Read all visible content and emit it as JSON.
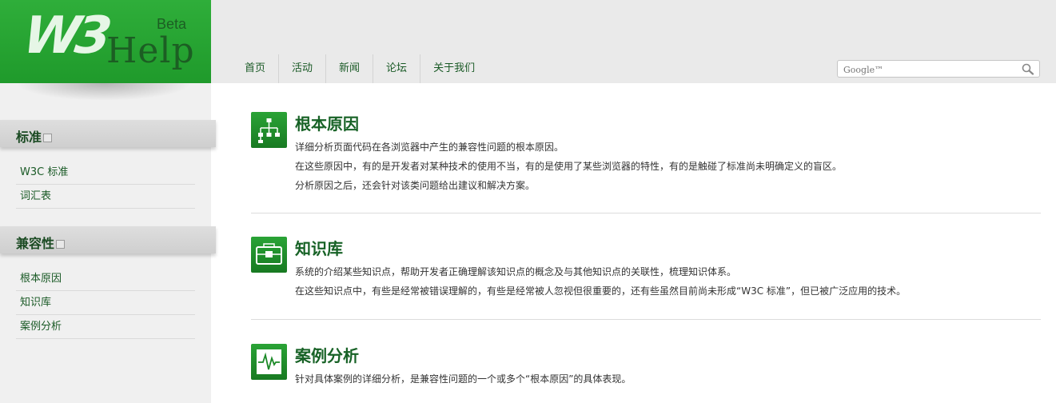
{
  "brand": {
    "logo_w3": "W3",
    "logo_help": "Help",
    "logo_beta": "Beta"
  },
  "nav": [
    {
      "label": "首页"
    },
    {
      "label": "活动"
    },
    {
      "label": "新闻"
    },
    {
      "label": "论坛"
    },
    {
      "label": "关于我们"
    }
  ],
  "search": {
    "placeholder": "Google™",
    "value": ""
  },
  "sidebar": {
    "sections": [
      {
        "title": "标准",
        "items": [
          {
            "label": "W3C 标准"
          },
          {
            "label": "词汇表"
          }
        ]
      },
      {
        "title": "兼容性",
        "items": [
          {
            "label": "根本原因"
          },
          {
            "label": "知识库"
          },
          {
            "label": "案例分析"
          }
        ]
      }
    ]
  },
  "entries": [
    {
      "title": "根本原因",
      "icon": "hierarchy-icon",
      "lines": [
        "详细分析页面代码在各浏览器中产生的兼容性问题的根本原因。",
        "在这些原因中，有的是开发者对某种技术的使用不当，有的是使用了某些浏览器的特性，有的是触碰了标准尚未明确定义的盲区。",
        "分析原因之后，还会针对该类问题给出建议和解决方案。"
      ]
    },
    {
      "title": "知识库",
      "icon": "toolbox-icon",
      "lines": [
        "系统的介绍某些知识点，帮助开发者正确理解该知识点的概念及与其他知识点的关联性，梳理知识体系。",
        "在这些知识点中，有些是经常被错误理解的，有些是经常被人忽视但很重要的，还有些虽然目前尚未形成“W3C 标准”，但已被广泛应用的技术。"
      ]
    },
    {
      "title": "案例分析",
      "icon": "waveform-icon",
      "lines": [
        "针对具体案例的详细分析，是兼容性问题的一个或多个“根本原因”的具体表现。"
      ]
    }
  ],
  "colors": {
    "brand_green": "#22a22f",
    "link_green": "#1a5a26",
    "title_green": "#176226"
  }
}
